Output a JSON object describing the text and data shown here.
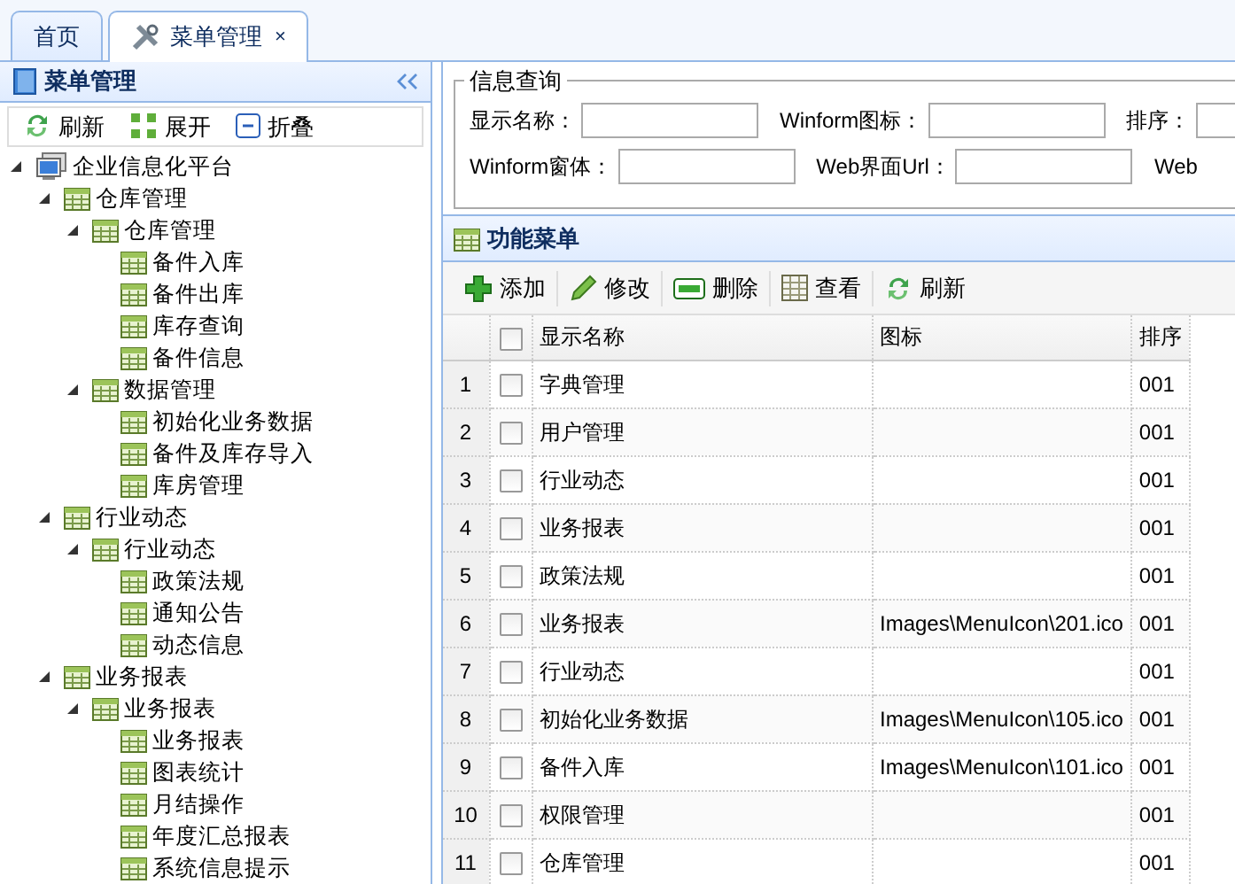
{
  "tabs": [
    {
      "label": "首页",
      "selected": false
    },
    {
      "label": "菜单管理",
      "selected": true,
      "close": "×"
    }
  ],
  "sidebar": {
    "title": "菜单管理",
    "toolbar": [
      {
        "label": "刷新",
        "kind": "refresh"
      },
      {
        "label": "展开",
        "kind": "expand"
      },
      {
        "label": "折叠",
        "kind": "collapse"
      }
    ],
    "tree": [
      {
        "label": "企业信息化平台",
        "kind": "computer",
        "expanded": true,
        "children": [
          {
            "label": "仓库管理",
            "kind": "grid",
            "expanded": true,
            "children": [
              {
                "label": "仓库管理",
                "kind": "grid",
                "expanded": true,
                "children": [
                  {
                    "label": "备件入库",
                    "kind": "grid"
                  },
                  {
                    "label": "备件出库",
                    "kind": "grid"
                  },
                  {
                    "label": "库存查询",
                    "kind": "grid"
                  },
                  {
                    "label": "备件信息",
                    "kind": "grid"
                  }
                ]
              },
              {
                "label": "数据管理",
                "kind": "grid",
                "expanded": true,
                "children": [
                  {
                    "label": "初始化业务数据",
                    "kind": "grid"
                  },
                  {
                    "label": "备件及库存导入",
                    "kind": "grid"
                  },
                  {
                    "label": "库房管理",
                    "kind": "grid"
                  }
                ]
              }
            ]
          },
          {
            "label": "行业动态",
            "kind": "grid",
            "expanded": true,
            "children": [
              {
                "label": "行业动态",
                "kind": "grid",
                "expanded": true,
                "children": [
                  {
                    "label": "政策法规",
                    "kind": "grid"
                  },
                  {
                    "label": "通知公告",
                    "kind": "grid"
                  },
                  {
                    "label": "动态信息",
                    "kind": "grid"
                  }
                ]
              }
            ]
          },
          {
            "label": "业务报表",
            "kind": "grid",
            "expanded": true,
            "children": [
              {
                "label": "业务报表",
                "kind": "grid",
                "expanded": true,
                "children": [
                  {
                    "label": "业务报表",
                    "kind": "grid"
                  },
                  {
                    "label": "图表统计",
                    "kind": "grid"
                  },
                  {
                    "label": "月结操作",
                    "kind": "grid"
                  },
                  {
                    "label": "年度汇总报表",
                    "kind": "grid"
                  },
                  {
                    "label": "系统信息提示",
                    "kind": "grid"
                  }
                ]
              }
            ]
          }
        ]
      }
    ]
  },
  "query": {
    "title": "信息查询",
    "rows": [
      [
        {
          "label": "显示名称："
        },
        {
          "label": "Winform图标："
        },
        {
          "label": "排序："
        }
      ],
      [
        {
          "label": "Winform窗体："
        },
        {
          "label": "Web界面Url："
        },
        {
          "label": "Web"
        }
      ]
    ]
  },
  "grid": {
    "title": "功能菜单",
    "toolbar": [
      {
        "label": "添加",
        "kind": "add"
      },
      {
        "label": "修改",
        "kind": "edit"
      },
      {
        "label": "删除",
        "kind": "delete"
      },
      {
        "label": "查看",
        "kind": "view"
      },
      {
        "label": "刷新",
        "kind": "refresh"
      }
    ],
    "select_all_checked": false,
    "columns": [
      "显示名称",
      "图标",
      "排序"
    ],
    "rows": [
      {
        "index": "1",
        "checked": false,
        "name": "字典管理",
        "icon": "",
        "order": "001"
      },
      {
        "index": "2",
        "checked": false,
        "name": "用户管理",
        "icon": "",
        "order": "001"
      },
      {
        "index": "3",
        "checked": false,
        "name": "行业动态",
        "icon": "",
        "order": "001"
      },
      {
        "index": "4",
        "checked": false,
        "name": "业务报表",
        "icon": "",
        "order": "001"
      },
      {
        "index": "5",
        "checked": false,
        "name": "政策法规",
        "icon": "",
        "order": "001"
      },
      {
        "index": "6",
        "checked": false,
        "name": "业务报表",
        "icon": "Images\\MenuIcon\\201.ico",
        "order": "001"
      },
      {
        "index": "7",
        "checked": false,
        "name": "行业动态",
        "icon": "",
        "order": "001"
      },
      {
        "index": "8",
        "checked": false,
        "name": "初始化业务数据",
        "icon": "Images\\MenuIcon\\105.ico",
        "order": "001"
      },
      {
        "index": "9",
        "checked": false,
        "name": "备件入库",
        "icon": "Images\\MenuIcon\\101.ico",
        "order": "001"
      },
      {
        "index": "10",
        "checked": false,
        "name": "权限管理",
        "icon": "",
        "order": "001"
      },
      {
        "index": "11",
        "checked": false,
        "name": "仓库管理",
        "icon": "",
        "order": "001"
      }
    ]
  }
}
